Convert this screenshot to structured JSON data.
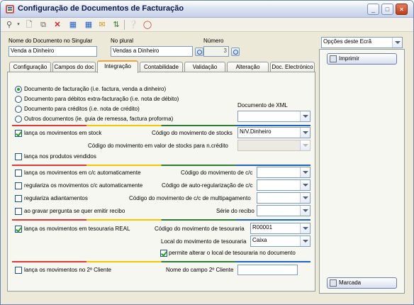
{
  "window": {
    "title": "Configuração de Documentos de Facturação"
  },
  "header": {
    "singular_label": "Nome do Documento no Singular",
    "singular_value": "Venda a Dinheiro",
    "plural_label": "No plural",
    "plural_value": "Vendas a Dinheiro",
    "numero_label": "Número",
    "numero_value": "3"
  },
  "tabs": [
    "Configuração",
    "Campos do doc",
    "Integração",
    "Contabilidade",
    "Validação",
    "Alteração",
    "Doc. Electrónico"
  ],
  "integracao": {
    "doc_types": [
      {
        "label": "Documento de facturação  (i.e. factura, venda a dinheiro)",
        "selected": true
      },
      {
        "label": "Documento para débitos extra-facturação (i.e. nota de débito)",
        "selected": false
      },
      {
        "label": "Documento para créditos (i.e. nota de crédito)",
        "selected": false
      },
      {
        "label": "Outros documentos (ie. guia de remessa, factura proforma)",
        "selected": false
      }
    ],
    "doc_xml_label": "Documento de XML",
    "doc_xml_value": "",
    "stock_check_label": "lança os movimentos em stock",
    "stock_code_label": "Código do movimento de stocks",
    "stock_code_value": "N/V.Dinheiro",
    "stock_value_label": "Código do movimento em valor de stocks para n.crédito",
    "stock_value_value": "",
    "produtos_vendidos_label": "lança nos produtos vendidos",
    "cc_check_label": "lança os movimentos em c/c automaticamente",
    "cc_code_label": "Código do movimento de c/c",
    "cc_code_value": "",
    "regulariza_check_label": "regulariza os movimentos c/c automaticamente",
    "regulariza_code_label": "Código de auto-regularização de c/c",
    "regulariza_code_value": "",
    "adiantamentos_label": "regulariza adiantamentos",
    "multipag_label": "Código do movimento de c/c de multipagamento",
    "multipag_value": "",
    "recibo_check_label": "ao gravar pergunta se quer emitir recibo",
    "recibo_serie_label": "Série do recibo",
    "recibo_serie_value": "",
    "tesouraria_check_label": "lança os movimentos em tesouraria REAL",
    "tesouraria_code_label": "Código do movimento de tesouraria",
    "tesouraria_code_value": "R00001",
    "tesouraria_local_label": "Local do movimento de tesouraria",
    "tesouraria_local_value": "Caixa",
    "permite_alterar_label": "permite alterar o local de tesouraria no documento",
    "segundo_cliente_label": "lança os movimentos no 2º Cliente",
    "segundo_cliente_field_label": "Nome do campo 2º Cliente",
    "segundo_cliente_field_value": ""
  },
  "right": {
    "options_value": "Opções deste Ecrã",
    "imprimir_label": "Imprimir",
    "marcada_label": "Marcada"
  }
}
